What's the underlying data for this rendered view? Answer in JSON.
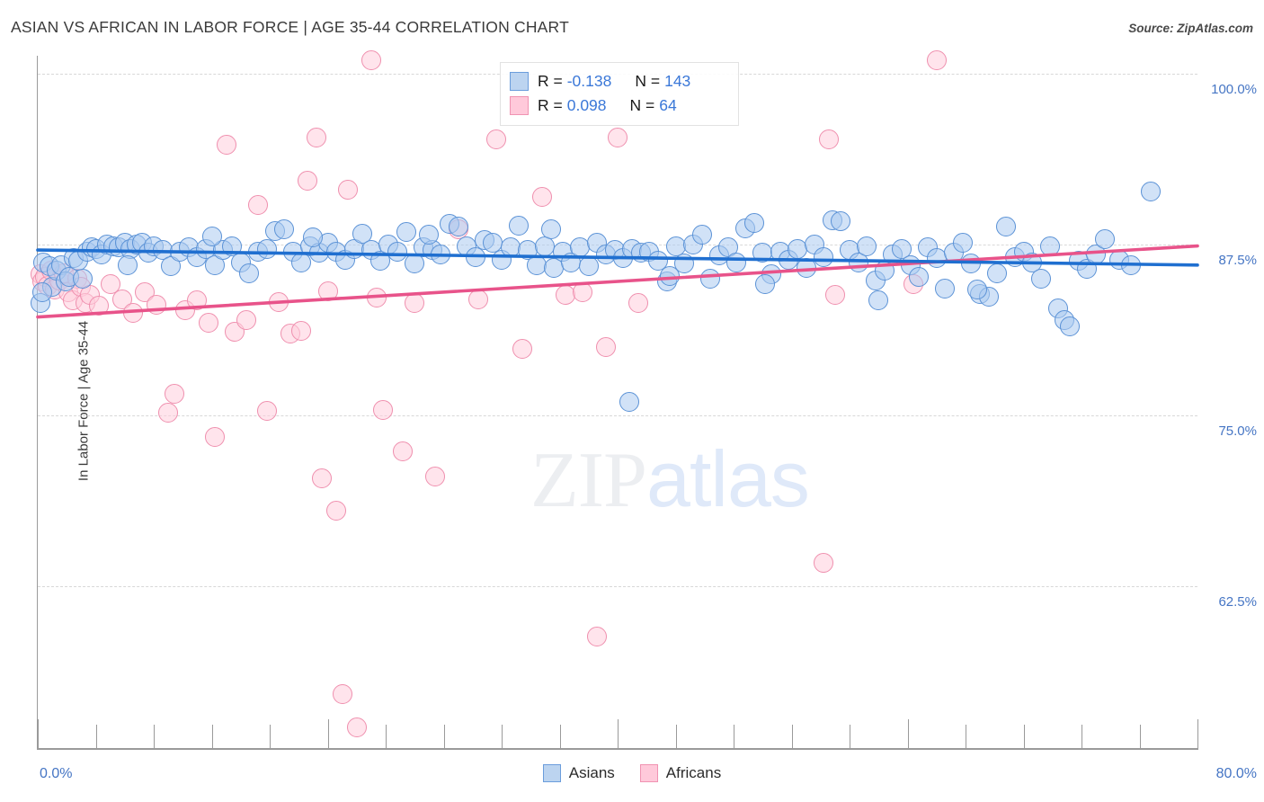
{
  "header": {
    "title": "ASIAN VS AFRICAN IN LABOR FORCE | AGE 35-44 CORRELATION CHART",
    "source": "Source: ZipAtlas.com"
  },
  "watermark": {
    "part1": "ZIP",
    "part2": "atlas"
  },
  "axes": {
    "ylabel": "In Labor Force | Age 35-44",
    "x_min_label": "0.0%",
    "x_max_label": "80.0%",
    "y_tick_labels": [
      "100.0%",
      "87.5%",
      "75.0%",
      "62.5%"
    ]
  },
  "stats": {
    "rows": [
      {
        "series": "Asians",
        "r_label": "R =",
        "r_value": "-0.138",
        "n_label": "N =",
        "n_value": "143"
      },
      {
        "series": "Africans",
        "r_label": "R =",
        "r_value": "0.098",
        "n_label": "N =",
        "n_value": "64"
      }
    ]
  },
  "legend": {
    "items": [
      {
        "label": "Asians",
        "color": "#bcd4f0"
      },
      {
        "label": "Africans",
        "color": "#ffc9da"
      }
    ]
  },
  "colors": {
    "asian_fill": "#acd0f0",
    "asian_stroke": "#5b92d6",
    "african_fill": "#ffcddc",
    "african_stroke": "#ef8fae",
    "asian_trend": "#1f6fd0",
    "african_trend": "#e8538a",
    "tick_text": "#4575c4",
    "grid": "#d8d8d8"
  },
  "chart_data": {
    "type": "scatter",
    "title": "ASIAN VS AFRICAN IN LABOR FORCE | AGE 35-44 CORRELATION CHART",
    "xlabel": "",
    "ylabel": "In Labor Force | Age 35-44",
    "xlim": [
      0,
      80
    ],
    "ylim": [
      52.0,
      102.5
    ],
    "x_unit": "%",
    "y_unit": "%",
    "grid": true,
    "y_ticks": [
      62.5,
      75.0,
      87.5,
      100.0
    ],
    "x_ticks": [
      0,
      80
    ],
    "legend_position": "bottom-center",
    "series": [
      {
        "name": "Asians",
        "color": "#acd0f0",
        "r": -0.138,
        "n": 143,
        "trendline": {
          "x0": 0,
          "y0": 87.1,
          "x1": 80,
          "y1": 86.0
        },
        "points": [
          [
            0.2,
            83.2
          ],
          [
            0.4,
            86.2
          ],
          [
            0.8,
            85.9
          ],
          [
            1.0,
            84.4
          ],
          [
            1.3,
            85.6
          ],
          [
            1.6,
            86.0
          ],
          [
            1.9,
            84.8
          ],
          [
            2.2,
            85.1
          ],
          [
            2.5,
            86.5
          ],
          [
            2.8,
            86.3
          ],
          [
            3.1,
            85.0
          ],
          [
            3.4,
            87.0
          ],
          [
            3.7,
            87.3
          ],
          [
            4.0,
            87.2
          ],
          [
            4.4,
            86.8
          ],
          [
            4.8,
            87.5
          ],
          [
            5.2,
            87.4
          ],
          [
            5.6,
            87.3
          ],
          [
            6.0,
            87.6
          ],
          [
            6.4,
            87.2
          ],
          [
            6.8,
            87.5
          ],
          [
            7.2,
            87.6
          ],
          [
            7.6,
            86.9
          ],
          [
            8.0,
            87.4
          ],
          [
            8.6,
            87.1
          ],
          [
            9.2,
            85.9
          ],
          [
            9.8,
            87.0
          ],
          [
            10.4,
            87.3
          ],
          [
            11.0,
            86.6
          ],
          [
            11.6,
            87.2
          ],
          [
            12.2,
            86.0
          ],
          [
            12.8,
            87.1
          ],
          [
            13.4,
            87.4
          ],
          [
            14.0,
            86.2
          ],
          [
            14.6,
            85.4
          ],
          [
            15.2,
            87.0
          ],
          [
            15.8,
            87.2
          ],
          [
            16.4,
            88.5
          ],
          [
            17.0,
            88.6
          ],
          [
            17.6,
            87.0
          ],
          [
            18.2,
            86.2
          ],
          [
            18.8,
            87.4
          ],
          [
            19.4,
            86.9
          ],
          [
            20.0,
            87.6
          ],
          [
            20.6,
            87.0
          ],
          [
            21.2,
            86.4
          ],
          [
            21.8,
            87.2
          ],
          [
            22.4,
            88.3
          ],
          [
            23.0,
            87.1
          ],
          [
            23.6,
            86.3
          ],
          [
            24.2,
            87.5
          ],
          [
            24.8,
            87.0
          ],
          [
            25.4,
            88.4
          ],
          [
            26.0,
            86.1
          ],
          [
            26.6,
            87.3
          ],
          [
            27.2,
            87.1
          ],
          [
            27.8,
            86.8
          ],
          [
            28.4,
            89.0
          ],
          [
            29.0,
            88.8
          ],
          [
            29.6,
            87.4
          ],
          [
            30.2,
            86.6
          ],
          [
            30.8,
            87.8
          ],
          [
            31.4,
            87.6
          ],
          [
            32.0,
            86.4
          ],
          [
            32.6,
            87.3
          ],
          [
            33.2,
            88.9
          ],
          [
            33.8,
            87.1
          ],
          [
            34.4,
            86.0
          ],
          [
            35.0,
            87.4
          ],
          [
            35.6,
            85.8
          ],
          [
            36.2,
            87.0
          ],
          [
            36.8,
            86.2
          ],
          [
            37.4,
            87.3
          ],
          [
            38.0,
            85.9
          ],
          [
            38.6,
            87.6
          ],
          [
            39.2,
            86.8
          ],
          [
            39.8,
            87.1
          ],
          [
            40.4,
            86.5
          ],
          [
            41.0,
            87.2
          ],
          [
            41.6,
            86.9
          ],
          [
            42.2,
            87.0
          ],
          [
            42.8,
            86.3
          ],
          [
            43.4,
            84.8
          ],
          [
            44.0,
            87.4
          ],
          [
            44.6,
            86.1
          ],
          [
            45.2,
            87.5
          ],
          [
            45.8,
            88.2
          ],
          [
            46.4,
            85.0
          ],
          [
            47.0,
            86.7
          ],
          [
            47.6,
            87.3
          ],
          [
            48.2,
            86.2
          ],
          [
            48.8,
            88.7
          ],
          [
            49.4,
            89.1
          ],
          [
            50.0,
            86.9
          ],
          [
            50.6,
            85.3
          ],
          [
            51.2,
            87.0
          ],
          [
            51.8,
            86.4
          ],
          [
            52.4,
            87.2
          ],
          [
            53.0,
            85.8
          ],
          [
            53.6,
            87.5
          ],
          [
            54.2,
            86.6
          ],
          [
            54.8,
            89.3
          ],
          [
            55.4,
            89.2
          ],
          [
            56.0,
            87.1
          ],
          [
            56.6,
            86.2
          ],
          [
            57.2,
            87.4
          ],
          [
            57.8,
            84.9
          ],
          [
            58.4,
            85.6
          ],
          [
            59.0,
            86.8
          ],
          [
            59.6,
            87.2
          ],
          [
            60.2,
            86.0
          ],
          [
            60.8,
            85.1
          ],
          [
            61.4,
            87.3
          ],
          [
            62.0,
            86.5
          ],
          [
            62.6,
            84.3
          ],
          [
            63.2,
            86.9
          ],
          [
            63.8,
            87.6
          ],
          [
            64.4,
            86.1
          ],
          [
            65.0,
            83.9
          ],
          [
            65.6,
            83.7
          ],
          [
            66.2,
            85.4
          ],
          [
            66.8,
            88.8
          ],
          [
            67.4,
            86.6
          ],
          [
            68.0,
            87.0
          ],
          [
            68.6,
            86.2
          ],
          [
            69.2,
            85.0
          ],
          [
            69.8,
            87.4
          ],
          [
            70.4,
            82.8
          ],
          [
            70.8,
            82.0
          ],
          [
            71.2,
            81.5
          ],
          [
            71.8,
            86.3
          ],
          [
            72.4,
            85.7
          ],
          [
            73.0,
            86.8
          ],
          [
            73.6,
            87.9
          ],
          [
            74.6,
            86.4
          ],
          [
            75.4,
            86.0
          ],
          [
            76.8,
            91.4
          ],
          [
            40.8,
            76.0
          ],
          [
            43.6,
            85.2
          ],
          [
            35.4,
            88.6
          ],
          [
            12.0,
            88.1
          ],
          [
            27.0,
            88.2
          ],
          [
            19.0,
            88.0
          ],
          [
            0.3,
            84.0
          ],
          [
            6.2,
            86.0
          ],
          [
            50.2,
            84.6
          ],
          [
            58.0,
            83.4
          ],
          [
            64.8,
            84.2
          ]
        ]
      },
      {
        "name": "Africans",
        "color": "#ffcddc",
        "r": 0.098,
        "n": 64,
        "trendline": {
          "x0": 0,
          "y0": 82.2,
          "x1": 80,
          "y1": 87.4
        },
        "points": [
          [
            0.2,
            85.3
          ],
          [
            0.3,
            84.8
          ],
          [
            0.5,
            85.1
          ],
          [
            0.7,
            84.5
          ],
          [
            0.9,
            85.6
          ],
          [
            1.2,
            84.2
          ],
          [
            1.5,
            84.9
          ],
          [
            1.8,
            85.4
          ],
          [
            2.1,
            84.0
          ],
          [
            2.4,
            83.4
          ],
          [
            2.7,
            85.0
          ],
          [
            3.0,
            84.4
          ],
          [
            3.3,
            83.2
          ],
          [
            3.6,
            83.8
          ],
          [
            4.2,
            83.0
          ],
          [
            5.0,
            84.6
          ],
          [
            5.8,
            83.5
          ],
          [
            6.6,
            82.5
          ],
          [
            7.4,
            84.0
          ],
          [
            8.2,
            83.1
          ],
          [
            9.0,
            75.2
          ],
          [
            9.4,
            76.6
          ],
          [
            10.2,
            82.7
          ],
          [
            11.0,
            83.4
          ],
          [
            11.8,
            81.8
          ],
          [
            12.2,
            73.4
          ],
          [
            13.0,
            94.8
          ],
          [
            13.6,
            81.1
          ],
          [
            14.4,
            82.0
          ],
          [
            15.2,
            90.4
          ],
          [
            15.8,
            75.3
          ],
          [
            16.6,
            83.3
          ],
          [
            17.4,
            81.0
          ],
          [
            18.2,
            81.2
          ],
          [
            18.6,
            92.2
          ],
          [
            19.2,
            95.3
          ],
          [
            19.6,
            70.4
          ],
          [
            20.0,
            84.1
          ],
          [
            20.6,
            68.0
          ],
          [
            21.0,
            54.6
          ],
          [
            21.4,
            91.5
          ],
          [
            22.0,
            52.2
          ],
          [
            23.0,
            101.0
          ],
          [
            23.4,
            83.6
          ],
          [
            23.8,
            75.4
          ],
          [
            25.2,
            72.4
          ],
          [
            26.0,
            83.2
          ],
          [
            27.4,
            70.5
          ],
          [
            29.0,
            88.6
          ],
          [
            30.4,
            83.5
          ],
          [
            31.6,
            95.2
          ],
          [
            33.4,
            79.9
          ],
          [
            34.8,
            91.0
          ],
          [
            36.4,
            83.8
          ],
          [
            37.6,
            84.0
          ],
          [
            38.6,
            58.8
          ],
          [
            39.2,
            80.0
          ],
          [
            40.0,
            95.3
          ],
          [
            41.4,
            83.2
          ],
          [
            54.6,
            95.2
          ],
          [
            54.2,
            64.2
          ],
          [
            55.0,
            83.8
          ],
          [
            62.0,
            101.0
          ],
          [
            60.4,
            84.6
          ]
        ]
      }
    ]
  }
}
